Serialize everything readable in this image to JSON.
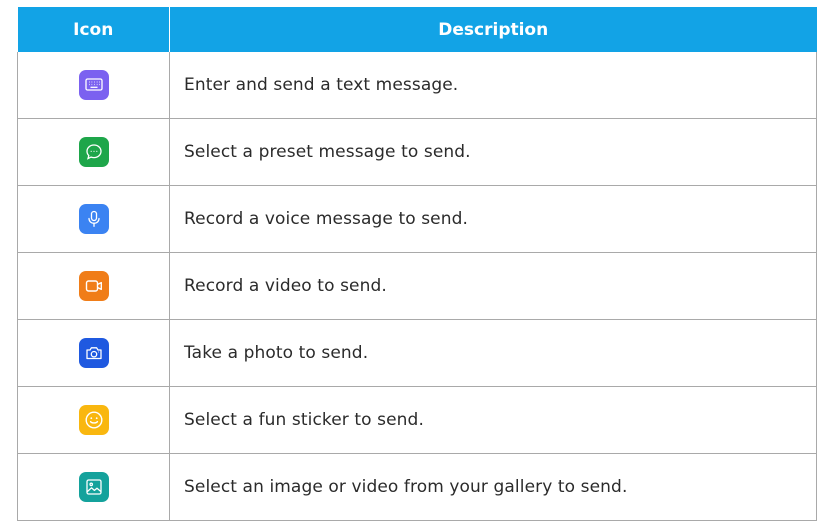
{
  "table": {
    "headers": {
      "icon": "Icon",
      "description": "Description"
    },
    "rows": [
      {
        "icon": "keyboard-icon",
        "color": "#7b61f0",
        "description": "Enter and send a text message."
      },
      {
        "icon": "chat-bubble-icon",
        "color": "#1ea64a",
        "description": "Select a preset message to send."
      },
      {
        "icon": "microphone-icon",
        "color": "#3b83f2",
        "description": "Record a voice message to send."
      },
      {
        "icon": "video-camera-icon",
        "color": "#f07d18",
        "description": "Record a video to send."
      },
      {
        "icon": "camera-icon",
        "color": "#1f59e0",
        "description": "Take a photo to send."
      },
      {
        "icon": "smiley-icon",
        "color": "#f9b70f",
        "description": "Select a fun sticker to send."
      },
      {
        "icon": "image-icon",
        "color": "#14a29c",
        "description": "Select an image or video from your gallery to send."
      }
    ]
  }
}
